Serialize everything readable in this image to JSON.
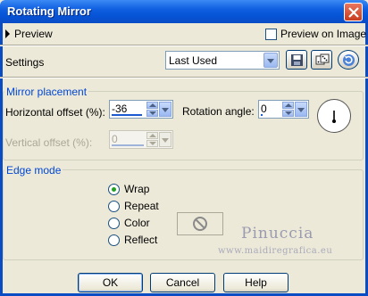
{
  "window": {
    "title": "Rotating Mirror"
  },
  "preview": {
    "label": "Preview",
    "on_image_label": "Preview on Image",
    "on_image_checked": false
  },
  "settings": {
    "label": "Settings",
    "selected": "Last Used"
  },
  "mirror_placement": {
    "legend": "Mirror placement",
    "horizontal_label": "Horizontal offset (%):",
    "horizontal_value": "-36",
    "vertical_label": "Vertical offset (%):",
    "vertical_value": "0",
    "vertical_enabled": false,
    "rotation_label": "Rotation angle:",
    "rotation_value": "0"
  },
  "edge_mode": {
    "legend": "Edge mode",
    "options": [
      "Wrap",
      "Repeat",
      "Color",
      "Reflect"
    ],
    "selected": "Wrap"
  },
  "watermark": {
    "name": "Pinuccia",
    "url": "www.maidiregrafica.eu"
  },
  "buttons": {
    "ok": "OK",
    "cancel": "Cancel",
    "help": "Help"
  },
  "icons": {
    "save": "save-icon",
    "dice": "dice-icon",
    "reset": "reset-icon",
    "dial": "rotation-dial-icon",
    "color_disabled": "no-color-icon"
  },
  "colors": {
    "titlebar": "#0a4cc4",
    "group_label": "#0046d5",
    "radio_dot": "#21a121"
  }
}
